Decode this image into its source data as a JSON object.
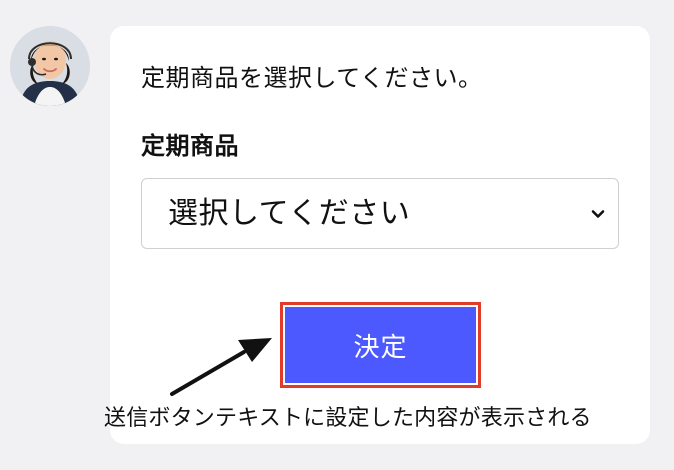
{
  "chat": {
    "avatar_icon": "operator-avatar",
    "message": "定期商品を選択してください。",
    "field_label": "定期商品",
    "select": {
      "value": "選択してください",
      "icon": "chevron-down-icon"
    },
    "submit_label": "決定",
    "annotation": "送信ボタンテキストに設定した内容が表示される"
  },
  "colors": {
    "page_background": "#f1f1f3",
    "bubble_background": "#ffffff",
    "button": "#4c59ff",
    "highlight_border": "#e23b2a",
    "arrow": "#111111"
  }
}
